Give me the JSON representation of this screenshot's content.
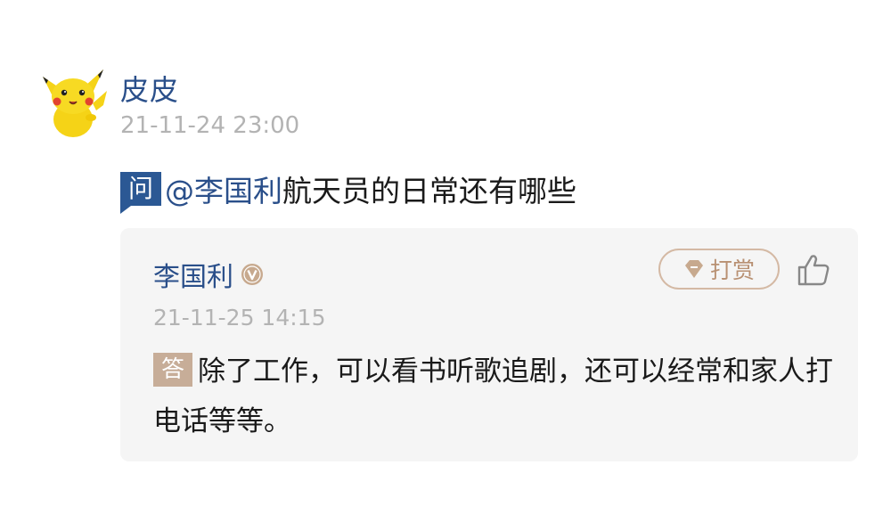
{
  "post": {
    "author": "皮皮",
    "time": "21-11-24 23:00",
    "avatar_icon": "pikachu-avatar",
    "ask_badge": "问",
    "mention": "@李国利",
    "question": "航天员的日常还有哪些"
  },
  "answer": {
    "answerer": "李国利",
    "verified_icon": "verified-v-icon",
    "time": "21-11-25 14:15",
    "tip_label": "打赏",
    "tip_icon": "diamond-icon",
    "like_icon": "thumbs-up-icon",
    "answer_badge": "答",
    "text": "除了工作，可以看书听歌追剧，还可以经常和家人打电话等等。"
  },
  "colors": {
    "accent_blue": "#2b5894",
    "name_blue": "#2a4f8a",
    "gold": "#c7ad98",
    "timestamp_gray": "#b3b3b3",
    "card_bg": "#f5f5f5"
  }
}
